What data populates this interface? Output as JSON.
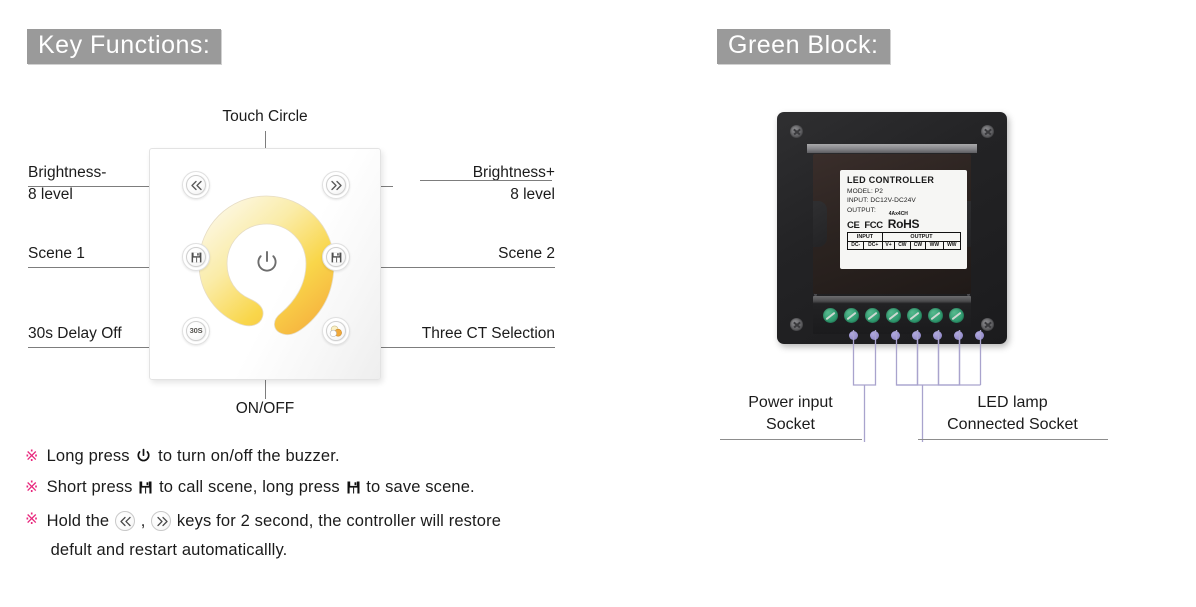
{
  "headings": {
    "key_functions": "Key Functions:",
    "green_block": "Green Block:"
  },
  "touch_panel": {
    "center_label": "Touch Circle",
    "bottom_label": "ON/OFF",
    "keys": [
      {
        "name": "brightness-down",
        "glyph": "«",
        "label_line1": "Brightness-",
        "label_line2": "8 level"
      },
      {
        "name": "brightness-up",
        "glyph": "»",
        "label_line1": "Brightness+",
        "label_line2": "8 level"
      },
      {
        "name": "scene-1",
        "glyph": "save-icon",
        "label_line1": "Scene 1"
      },
      {
        "name": "scene-2",
        "glyph": "save-icon",
        "label_line1": "Scene 2"
      },
      {
        "name": "delay-off",
        "glyph": "30S",
        "label_line1": "30s Delay Off"
      },
      {
        "name": "ct-selection",
        "glyph": "ct-circles-icon",
        "label_line1": "Three CT Selection"
      }
    ],
    "labels": {
      "brightness_down_1": "Brightness-",
      "brightness_down_2": "8 level",
      "brightness_up_1": "Brightness+",
      "brightness_up_2": "8 level",
      "scene1": "Scene 1",
      "scene2": "Scene 2",
      "delay": "30s Delay Off",
      "ct": "Three CT Selection"
    },
    "delay_key_text": "30S"
  },
  "notes": {
    "mark": "※",
    "line1_a": "Long press",
    "line1_b": "to turn on/off the buzzer.",
    "line2_a": "Short press",
    "line2_b": "to call scene, long press",
    "line2_c": "to save scene.",
    "line3_a": "Hold the",
    "line3_comma": ",",
    "line3_b": "keys for 2 second, the controller will restore",
    "line3_c": "defult and restart automaticallly."
  },
  "green_block": {
    "label": {
      "title": "LED CONTROLLER",
      "model": "MODEL: P2",
      "input": "INPUT:  DC12V-DC24V",
      "output": "OUTPUT:",
      "cert_ce": "CE",
      "cert_fcc": "FCC",
      "cert_rohs": "RoHS",
      "cert_rohs_sup": "4Ax4CH",
      "table": {
        "group_input": "INPUT",
        "group_output": "OUTPUT",
        "cells": [
          "DC-",
          "DC+",
          "V+",
          "CW",
          "CW",
          "WW",
          "WW"
        ]
      }
    },
    "terminals_count": 7,
    "callouts": {
      "power_line1": "Power input",
      "power_line2": "Socket",
      "led_line1": "LED lamp",
      "led_line2": "Connected Socket"
    }
  },
  "colors": {
    "heading_bg": "#9a9a9a",
    "note_mark": "#e8277d",
    "terminal_green": "#35a075",
    "pin_purple": "#9a92cf",
    "touch_warm": "#f5b731"
  }
}
